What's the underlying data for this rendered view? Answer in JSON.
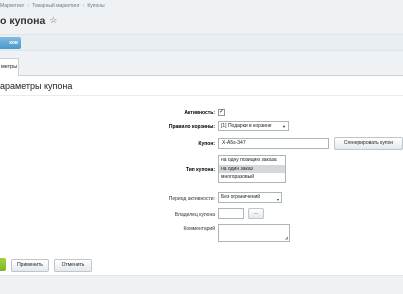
{
  "breadcrumbs": [
    "Маркетинг",
    "Товарный маркетинг",
    "Купоны"
  ],
  "page": {
    "title": "о купона"
  },
  "toolbar": {
    "coupons_label": "ков"
  },
  "tabs": [
    {
      "label": "метры"
    }
  ],
  "section": {
    "title": "араметры купона"
  },
  "form": {
    "active": {
      "label": "Активность:",
      "checked": true,
      "check_glyph": "✓"
    },
    "basket_rule": {
      "label": "Правило корзины:",
      "value": "[1] Подарки в корзине"
    },
    "coupon": {
      "label": "Купон:",
      "value": "X-A5s-347",
      "generate_label": "Сгенерировать купон"
    },
    "coupon_type": {
      "label": "Тип купона:",
      "options": [
        "на одну позицию заказа",
        "на один заказ",
        "многоразовый"
      ],
      "selected_index": 1
    },
    "period": {
      "label": "Период активности:",
      "value": "Без ограничений"
    },
    "owner": {
      "label": "Владелец купона",
      "browse_label": "..."
    },
    "comment": {
      "label": "Комментарий"
    }
  },
  "buttons": {
    "apply": "Применить",
    "cancel": "Отменить"
  },
  "colors": {
    "accent_blue": "#4c98c9",
    "save_green": "#7fb52a"
  }
}
